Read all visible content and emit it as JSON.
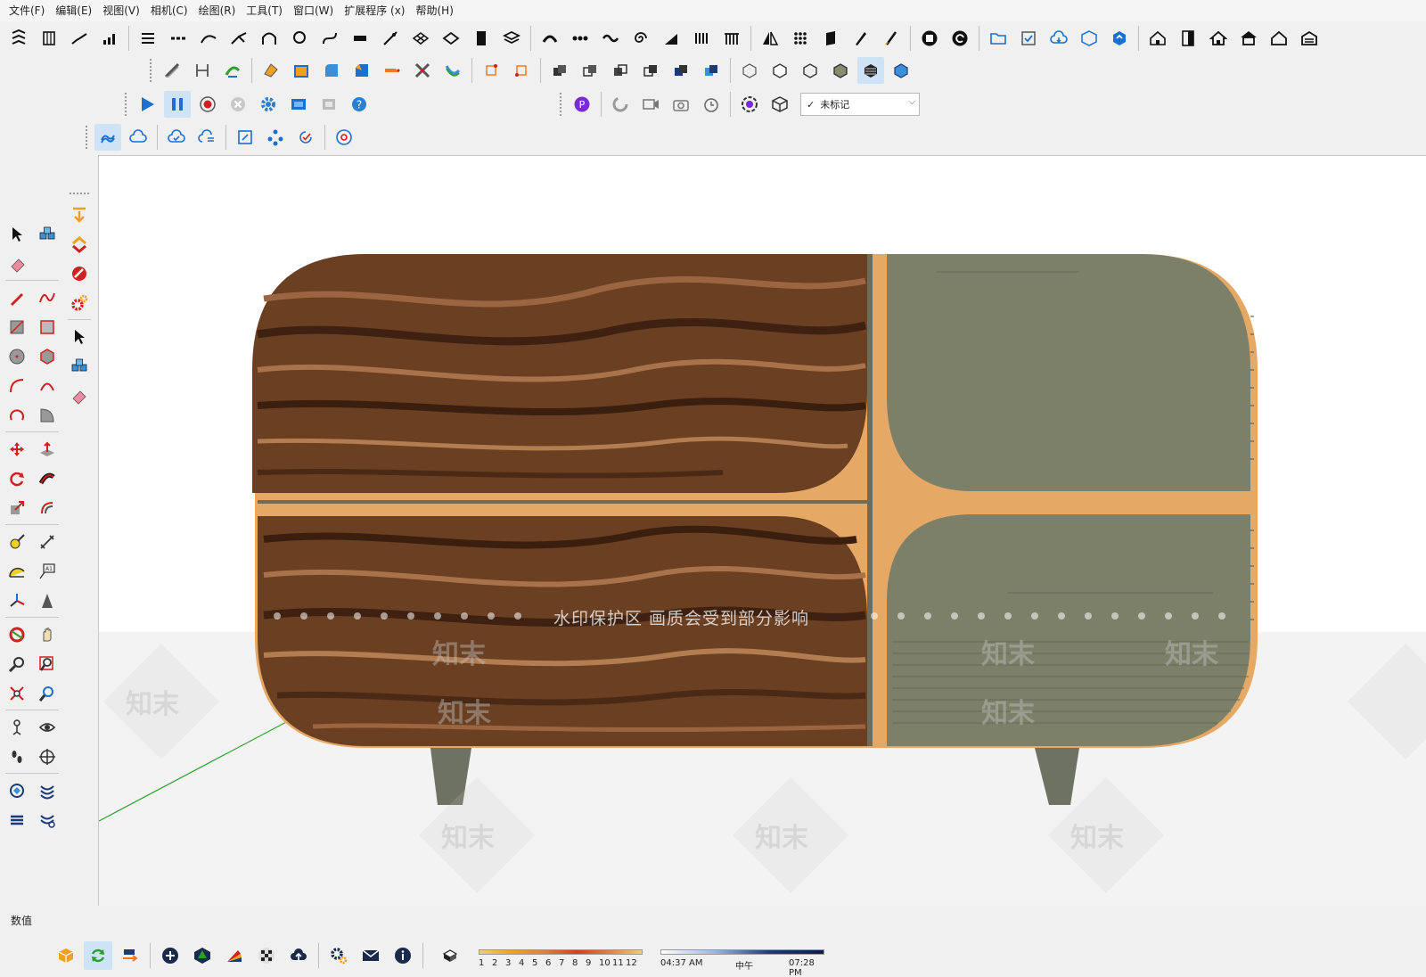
{
  "menu": [
    "文件(F)",
    "编辑(E)",
    "视图(V)",
    "相机(C)",
    "绘图(R)",
    "工具(T)",
    "窗口(W)",
    "扩展程序 (x)",
    "帮助(H)"
  ],
  "tag_dropdown": {
    "value": "未标记",
    "check": "✓"
  },
  "status": {
    "measurements_label": "数值"
  },
  "watermark": {
    "text": "水印保护区   画质会受到部分影响",
    "logo": "知末"
  },
  "shadow": {
    "month_ticks": [
      "1",
      "2",
      "3",
      "4",
      "5",
      "6",
      "7",
      "8",
      "9",
      "10",
      "11",
      "12"
    ],
    "time_start": "04:37 AM",
    "time_mid": "中午",
    "time_end": "07:28 PM"
  },
  "colors": {
    "wood_dark": "#5a3520",
    "wood_light": "#9a6640",
    "panel_gray": "#7c8068",
    "accent_orange": "#e6a865",
    "toolbar_bg": "#f0f0f0",
    "viewport_bg": "#ffffff",
    "axis_green": "#2aa02a",
    "active_blue": "#cfe3f7",
    "button_blue": "#1a6fd0"
  }
}
